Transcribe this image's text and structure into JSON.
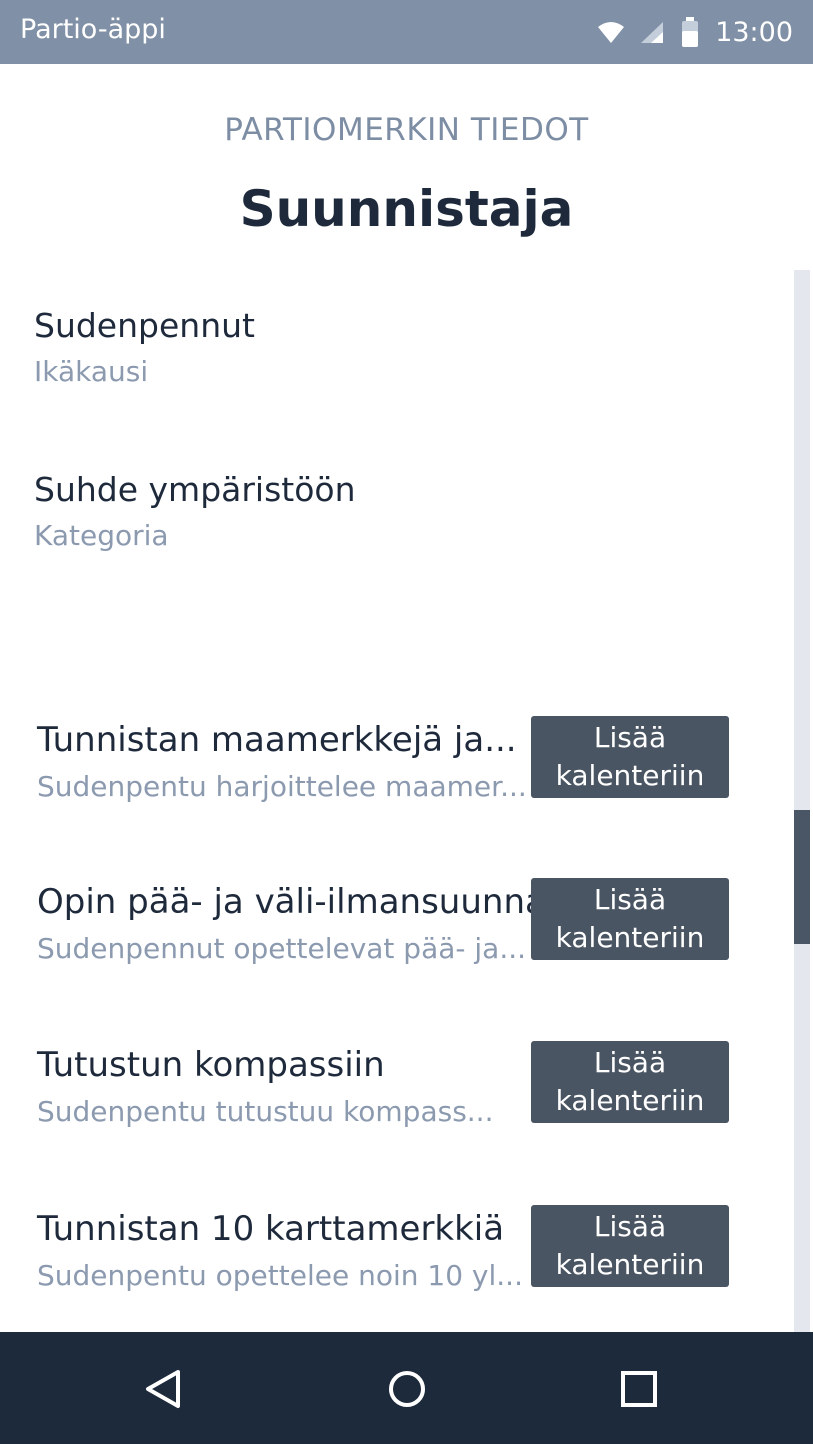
{
  "status_bar": {
    "app_title": "Partio-äppi",
    "time": "13:00",
    "icons": [
      "wifi-icon",
      "signal-icon",
      "battery-icon"
    ]
  },
  "header": {
    "subtitle": "PARTIOMERKIN TIEDOT",
    "title": "Suunnistaja"
  },
  "info": {
    "age_group": {
      "value": "Sudenpennut",
      "label": "Ikäkausi"
    },
    "category": {
      "value": "Suhde ympäristöön",
      "label": "Kategoria"
    }
  },
  "tasks": [
    {
      "title": "Tunnistan maamerkkejä ja...",
      "description": "Sudenpentu harjoittelee maamer...",
      "button": "Lisää kalenteriin"
    },
    {
      "title": "Opin pää- ja väli-ilmansuunnat",
      "description": "Sudenpennut opettelevat pää- ja...",
      "button": "Lisää kalenteriin"
    },
    {
      "title": "Tutustun kompassiin",
      "description": "Sudenpentu tutustuu kompass...",
      "button": "Lisää kalenteriin"
    },
    {
      "title": "Tunnistan 10 karttamerkkiä",
      "description": "Sudenpentu opettelee noin 10 yl...",
      "button": "Lisää kalenteriin"
    }
  ],
  "nav": {
    "icons": [
      "back-icon",
      "home-icon",
      "recents-icon"
    ]
  },
  "colors": {
    "status_bar": "#8090a6",
    "button": "#4a5563",
    "nav_bar": "#1d2a3b",
    "title_text": "#1e2a3b",
    "muted_text": "#8c9ab0"
  }
}
